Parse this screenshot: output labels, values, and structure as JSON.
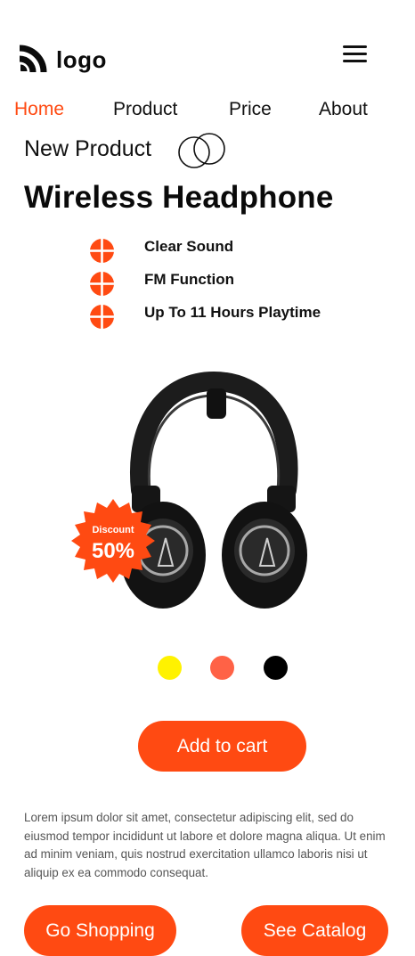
{
  "brand": {
    "logo_text": "logo",
    "logo_icon": "wifi-arcs-icon"
  },
  "header": {
    "menu_icon": "hamburger-icon"
  },
  "nav": [
    {
      "label": "Home",
      "active": true
    },
    {
      "label": "Product",
      "active": false
    },
    {
      "label": "Price",
      "active": false
    },
    {
      "label": "About",
      "active": false
    }
  ],
  "hero": {
    "eyebrow": "New Product",
    "title": "Wireless Headphone",
    "features": [
      "Clear Sound",
      "FM Function",
      "Up To 11 Hours Playtime"
    ],
    "feature_icon": "plus-circle-icon"
  },
  "product": {
    "badge_label": "Discount",
    "badge_value": "50%",
    "image": "headphones-image",
    "colors": [
      "#fff200",
      "#ff6246",
      "#000000"
    ]
  },
  "cart": {
    "add_label": "Add to cart"
  },
  "description": "Lorem ipsum dolor sit amet, consectetur adipiscing elit, sed do eiusmod tempor incididunt ut labore et dolore magna aliqua. Ut enim ad minim veniam, quis nostrud exercitation ullamco laboris nisi ut aliquip ex ea commodo consequat.",
  "actions": {
    "shop_label": "Go Shopping",
    "catalog_label": "See Catalog"
  },
  "palette": {
    "accent": "#ff4a12",
    "text": "#111111",
    "muted": "#555555"
  }
}
